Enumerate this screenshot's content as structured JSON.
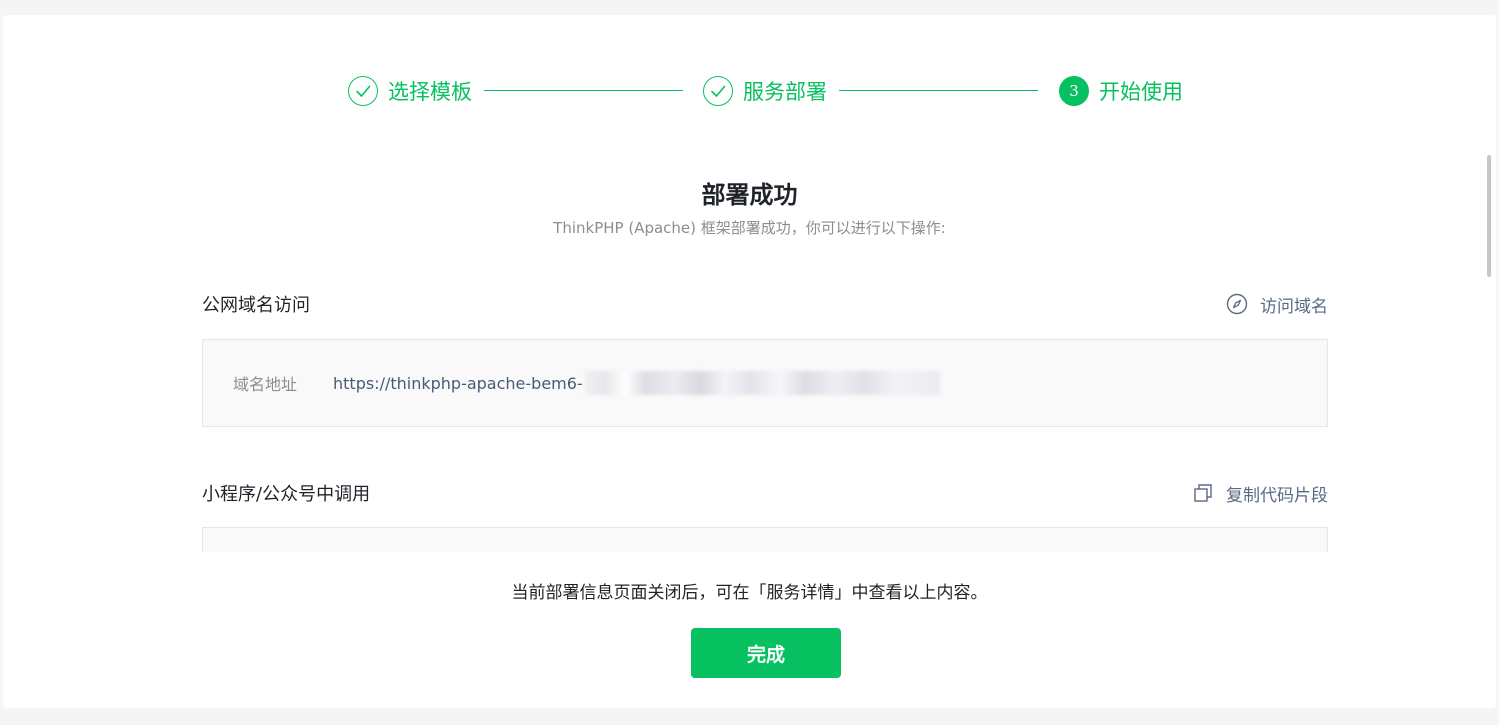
{
  "steps": [
    {
      "label": "选择模板",
      "status": "done",
      "icon": "check-icon"
    },
    {
      "label": "服务部署",
      "status": "done",
      "icon": "check-icon"
    },
    {
      "label": "开始使用",
      "status": "active",
      "number": "3"
    }
  ],
  "result": {
    "title": "部署成功",
    "description": "ThinkPHP (Apache) 框架部署成功，你可以进行以下操作:"
  },
  "public_domain": {
    "title": "公网域名访问",
    "action_label": "访问域名",
    "action_icon": "compass-icon",
    "field_label": "域名地址",
    "url_visible": "https://thinkphp-apache-bem6-"
  },
  "miniprogram": {
    "title": "小程序/公众号中调用",
    "action_label": "复制代码片段",
    "action_icon": "copy-icon"
  },
  "footer": {
    "note": "当前部署信息页面关闭后，可在「服务详情」中查看以上内容。",
    "done_label": "完成"
  },
  "colors": {
    "accent": "#07c160",
    "link": "#5a6a85",
    "text": "#1f2329",
    "muted": "#8a8d93"
  }
}
